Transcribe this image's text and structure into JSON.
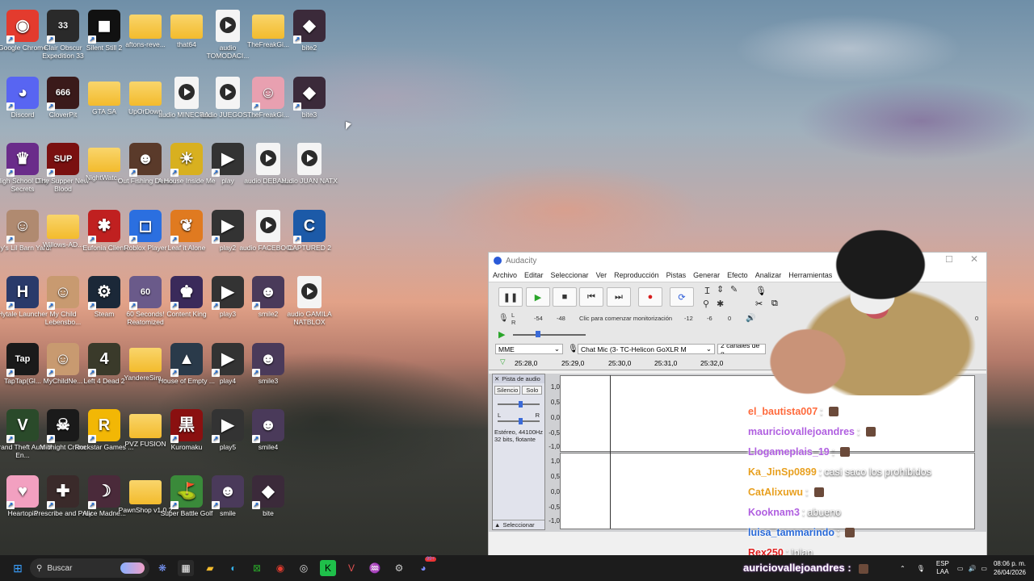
{
  "desktop": {
    "icons": [
      {
        "label": "Google Chrome",
        "kind": "app",
        "color": "#e33b2e",
        "glyph": "◉",
        "col": 0,
        "row": 0
      },
      {
        "label": "Clair Obscur Expedition 33",
        "kind": "app",
        "color": "#2a2a2a",
        "glyph": "33",
        "col": 1,
        "row": 0
      },
      {
        "label": "Silent Still 2",
        "kind": "app",
        "color": "#111111",
        "glyph": "◼",
        "col": 2,
        "row": 0
      },
      {
        "label": "aftons-reve...",
        "kind": "folder",
        "col": 3,
        "row": 0
      },
      {
        "label": "that64",
        "kind": "folder",
        "col": 4,
        "row": 0
      },
      {
        "label": "audio TOMODACI...",
        "kind": "audio",
        "col": 5,
        "row": 0
      },
      {
        "label": "TheFreakGi...",
        "kind": "folder",
        "col": 6,
        "row": 0
      },
      {
        "label": "bite2",
        "kind": "app",
        "color": "#3b2a3a",
        "glyph": "◆",
        "col": 7,
        "row": 0
      },
      {
        "label": "Discord",
        "kind": "app",
        "color": "#5865f2",
        "glyph": "◕",
        "col": 0,
        "row": 1
      },
      {
        "label": "CloverPit",
        "kind": "app",
        "color": "#3a1a1a",
        "glyph": "666",
        "col": 1,
        "row": 1
      },
      {
        "label": "GTA SA",
        "kind": "folder",
        "col": 2,
        "row": 1
      },
      {
        "label": "UpOrDown",
        "kind": "folder",
        "col": 3,
        "row": 1
      },
      {
        "label": "audio MINECRA...",
        "kind": "audio",
        "col": 4,
        "row": 1
      },
      {
        "label": "audio JUEGOS ...",
        "kind": "audio",
        "col": 5,
        "row": 1
      },
      {
        "label": "TheFreakGi...",
        "kind": "app",
        "color": "#e8a0b0",
        "glyph": "☺",
        "col": 6,
        "row": 1
      },
      {
        "label": "bite3",
        "kind": "app",
        "color": "#3b2a3a",
        "glyph": "◆",
        "col": 7,
        "row": 1
      },
      {
        "label": "High School Dirty Secrets",
        "kind": "app",
        "color": "#6a2c8a",
        "glyph": "♛",
        "col": 0,
        "row": 2
      },
      {
        "label": "The Supper New Blood",
        "kind": "app",
        "color": "#7a1010",
        "glyph": "SUP",
        "col": 1,
        "row": 2
      },
      {
        "label": "NightWatc...",
        "kind": "folder",
        "col": 2,
        "row": 2
      },
      {
        "label": "Out Fishing Demo",
        "kind": "app",
        "color": "#5a3a2a",
        "glyph": "☻",
        "col": 3,
        "row": 2
      },
      {
        "label": "A House Inside Me",
        "kind": "app",
        "color": "#d8b020",
        "glyph": "☀",
        "col": 4,
        "row": 2
      },
      {
        "label": "play",
        "kind": "app",
        "color": "#333333",
        "glyph": "▶",
        "col": 5,
        "row": 2
      },
      {
        "label": "audio DEBAH...",
        "kind": "audio",
        "col": 6,
        "row": 2
      },
      {
        "label": "audio JUAN NATX",
        "kind": "audio",
        "col": 7,
        "row": 2
      },
      {
        "label": "Lily's Lil Barn Yard!",
        "kind": "app",
        "color": "#b08a70",
        "glyph": "☺",
        "col": 0,
        "row": 3
      },
      {
        "label": "Willows-AD...",
        "kind": "folder",
        "col": 1,
        "row": 3
      },
      {
        "label": "Eufonia Client",
        "kind": "app",
        "color": "#c02020",
        "glyph": "✱",
        "col": 2,
        "row": 3
      },
      {
        "label": "Roblox Player",
        "kind": "app",
        "color": "#2b6fe0",
        "glyph": "◻",
        "col": 3,
        "row": 3
      },
      {
        "label": "Leaf it Alone",
        "kind": "app",
        "color": "#e07a20",
        "glyph": "❦",
        "col": 4,
        "row": 3
      },
      {
        "label": "play2",
        "kind": "app",
        "color": "#333333",
        "glyph": "▶",
        "col": 5,
        "row": 3
      },
      {
        "label": "audio FACEBOO...",
        "kind": "audio",
        "col": 6,
        "row": 3
      },
      {
        "label": "CAPTURED 2",
        "kind": "app",
        "color": "#1c5aa8",
        "glyph": "C",
        "col": 7,
        "row": 3
      },
      {
        "label": "Hytale Launcher",
        "kind": "app",
        "color": "#2a3a6a",
        "glyph": "H",
        "col": 0,
        "row": 4
      },
      {
        "label": "My Child Lebensbo...",
        "kind": "app",
        "color": "#c89a70",
        "glyph": "☺",
        "col": 1,
        "row": 4
      },
      {
        "label": "Steam",
        "kind": "app",
        "color": "#1b2838",
        "glyph": "⚙",
        "col": 2,
        "row": 4
      },
      {
        "label": "60 Seconds! Reatomized",
        "kind": "app",
        "color": "#6a5a8a",
        "glyph": "60",
        "col": 3,
        "row": 4
      },
      {
        "label": "Content King",
        "kind": "app",
        "color": "#3a2a5a",
        "glyph": "♚",
        "col": 4,
        "row": 4
      },
      {
        "label": "play3",
        "kind": "app",
        "color": "#333333",
        "glyph": "▶",
        "col": 5,
        "row": 4
      },
      {
        "label": "smile2",
        "kind": "app",
        "color": "#4a3a5a",
        "glyph": "☻",
        "col": 6,
        "row": 4
      },
      {
        "label": "audio GAMILA NATBLOX",
        "kind": "audio",
        "col": 7,
        "row": 4
      },
      {
        "label": "TapTap(Gl...",
        "kind": "app",
        "color": "#1a1a1a",
        "glyph": "Tap",
        "col": 0,
        "row": 5
      },
      {
        "label": "MyChildNe...",
        "kind": "app",
        "color": "#c89a70",
        "glyph": "☺",
        "col": 1,
        "row": 5
      },
      {
        "label": "Left 4 Dead 2",
        "kind": "app",
        "color": "#3a3a2a",
        "glyph": "4",
        "col": 2,
        "row": 5
      },
      {
        "label": "YandereSim...",
        "kind": "folder",
        "col": 3,
        "row": 5
      },
      {
        "label": "House of Empty ...",
        "kind": "app",
        "color": "#2a3a4a",
        "glyph": "▲",
        "col": 4,
        "row": 5
      },
      {
        "label": "play4",
        "kind": "app",
        "color": "#333333",
        "glyph": "▶",
        "col": 5,
        "row": 5
      },
      {
        "label": "smile3",
        "kind": "app",
        "color": "#4a3a5a",
        "glyph": "☻",
        "col": 6,
        "row": 5
      },
      {
        "label": "Grand Theft Auto V En...",
        "kind": "app",
        "color": "#2a4a2a",
        "glyph": "V",
        "col": 0,
        "row": 6
      },
      {
        "label": "Midnight Crane",
        "kind": "app",
        "color": "#1a1a1a",
        "glyph": "☠",
        "col": 1,
        "row": 6
      },
      {
        "label": "Rockstar Games ...",
        "kind": "app",
        "color": "#f2b705",
        "glyph": "R",
        "col": 2,
        "row": 6
      },
      {
        "label": "PVZ FUSION",
        "kind": "folder",
        "col": 3,
        "row": 6
      },
      {
        "label": "Kuromaku",
        "kind": "app",
        "color": "#8a1010",
        "glyph": "黒",
        "col": 4,
        "row": 6
      },
      {
        "label": "play5",
        "kind": "app",
        "color": "#333333",
        "glyph": "▶",
        "col": 5,
        "row": 6
      },
      {
        "label": "smile4",
        "kind": "app",
        "color": "#4a3a5a",
        "glyph": "☻",
        "col": 6,
        "row": 6
      },
      {
        "label": "Heartopia",
        "kind": "app",
        "color": "#f2a0c0",
        "glyph": "♥",
        "col": 0,
        "row": 7
      },
      {
        "label": "Prescribe and Pray",
        "kind": "app",
        "color": "#3a2a2a",
        "glyph": "✚",
        "col": 1,
        "row": 7
      },
      {
        "label": "Alice Madne...",
        "kind": "app",
        "color": "#4a2a3a",
        "glyph": "☽",
        "col": 2,
        "row": 7
      },
      {
        "label": "PawnShop v1.0.2",
        "kind": "folder",
        "col": 3,
        "row": 7
      },
      {
        "label": "Super Battle Golf",
        "kind": "app",
        "color": "#3a8a3a",
        "glyph": "⛳",
        "col": 4,
        "row": 7
      },
      {
        "label": "smile",
        "kind": "app",
        "color": "#4a3a5a",
        "glyph": "☻",
        "col": 5,
        "row": 7
      },
      {
        "label": "bite",
        "kind": "app",
        "color": "#3b2a3a",
        "glyph": "◆",
        "col": 6,
        "row": 7
      }
    ]
  },
  "audacity": {
    "title": "Audacity",
    "menu": [
      "Archivo",
      "Editar",
      "Seleccionar",
      "Ver",
      "Reproducción",
      "Pistas",
      "Generar",
      "Efecto",
      "Analizar",
      "Herramientas"
    ],
    "meter_scale": [
      "-54",
      "-48",
      "Clic para comenzar monitorización",
      "-12",
      "-6",
      "0"
    ],
    "meter_right": "0",
    "host": "MME",
    "input_device": "Chat Mic (3- TC-Helicon GoXLR M",
    "channels": "2 canales de g",
    "timeline": [
      "25:28,0",
      "25:29,0",
      "25:30,0",
      "25:31,0",
      "25:32,0"
    ],
    "track": {
      "name": "Pista de audio",
      "mute": "Silencio",
      "solo": "Solo",
      "pan_l": "L",
      "pan_r": "R",
      "info1": "Estéreo, 44100Hz",
      "info2": "32 bits, flotante",
      "select": "Seleccionar",
      "scale": [
        "1,0",
        "0,5",
        "0,0",
        "-0,5",
        "-1,0"
      ]
    }
  },
  "chat": [
    {
      "user": "el_bautista007",
      "color": "#ff6a3c",
      "text": "",
      "emote": true
    },
    {
      "user": "mauriciovallejoandres",
      "color": "#b05fe0",
      "text": "",
      "emote": true
    },
    {
      "user": "Llogameplais_19",
      "color": "#b05fe0",
      "text": "",
      "emote": true
    },
    {
      "user": "Ka_JinSp0899",
      "color": "#e8a020",
      "text": "casi saco los prohibidos",
      "emote": false
    },
    {
      "user": "CatAlixuwu",
      "color": "#e8a020",
      "text": "",
      "emote": true
    },
    {
      "user": "Kooknam3",
      "color": "#b05fe0",
      "text": "abueno",
      "emote": false
    },
    {
      "user": "luisa_tammarindo",
      "color": "#2a6ad8",
      "text": "",
      "emote": true
    },
    {
      "user": "Rex250",
      "color": "#e02020",
      "text": "!plan",
      "emote": false
    }
  ],
  "ticker": "auriciovallejoandres :",
  "taskbar": {
    "search_placeholder": "Buscar",
    "lang": "ESP",
    "lang2": "LAA",
    "time": "08:06 p. m.",
    "date": "26/04/2026",
    "badge": "99+"
  }
}
